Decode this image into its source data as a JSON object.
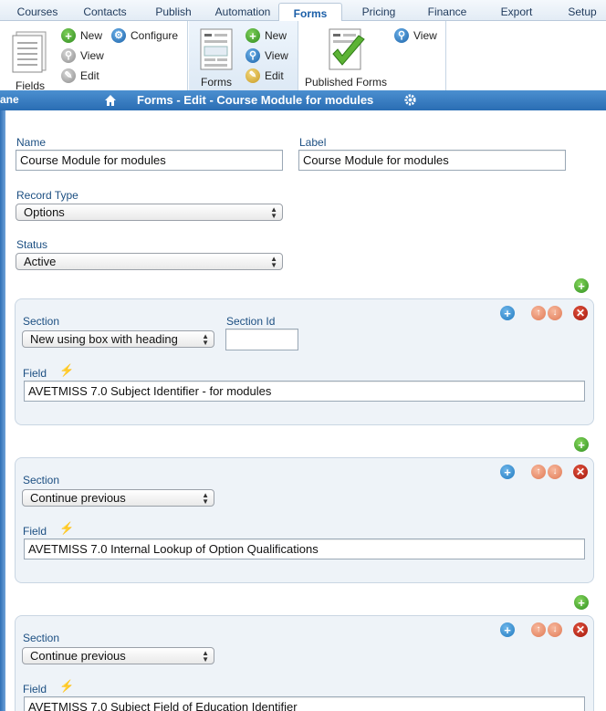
{
  "tabs": [
    {
      "label": "Courses"
    },
    {
      "label": "Contacts"
    },
    {
      "label": "Publish"
    },
    {
      "label": "Automation"
    },
    {
      "label": "Forms"
    },
    {
      "label": "Pricing"
    },
    {
      "label": "Finance"
    },
    {
      "label": "Export"
    },
    {
      "label": "Setup"
    }
  ],
  "ribbon": {
    "fields_group": {
      "big_label": "Fields",
      "new": "New",
      "view": "View",
      "edit": "Edit",
      "configure": "Configure"
    },
    "forms_group": {
      "big_label": "Forms",
      "new": "New",
      "view": "View",
      "edit": "Edit"
    },
    "published_group": {
      "big_label": "Published Forms",
      "view": "View"
    }
  },
  "titlebar": {
    "left_text": "ane",
    "title": "Forms - Edit - Course Module for modules"
  },
  "form": {
    "name_label": "Name",
    "name_value": "Course Module for modules",
    "label_label": "Label",
    "label_value": "Course Module for modules",
    "record_type_label": "Record Type",
    "record_type_value": "Options",
    "status_label": "Status",
    "status_value": "Active"
  },
  "sections": [
    {
      "section_label": "Section",
      "section_value": "New using box with heading",
      "section_id_label": "Section Id",
      "section_id_value": "",
      "field_label": "Field",
      "field_value": "AVETMISS 7.0 Subject Identifier - for modules"
    },
    {
      "section_label": "Section",
      "section_value": "Continue previous",
      "field_label": "Field",
      "field_value": "AVETMISS 7.0 Internal Lookup of Option Qualifications"
    },
    {
      "section_label": "Section",
      "section_value": "Continue previous",
      "field_label": "Field",
      "field_value": "AVETMISS 7.0 Subject Field of Education Identifier"
    }
  ],
  "colors": {
    "accent": "#2a6db3",
    "card_bg": "#eef3f8",
    "label": "#1c4f82"
  }
}
